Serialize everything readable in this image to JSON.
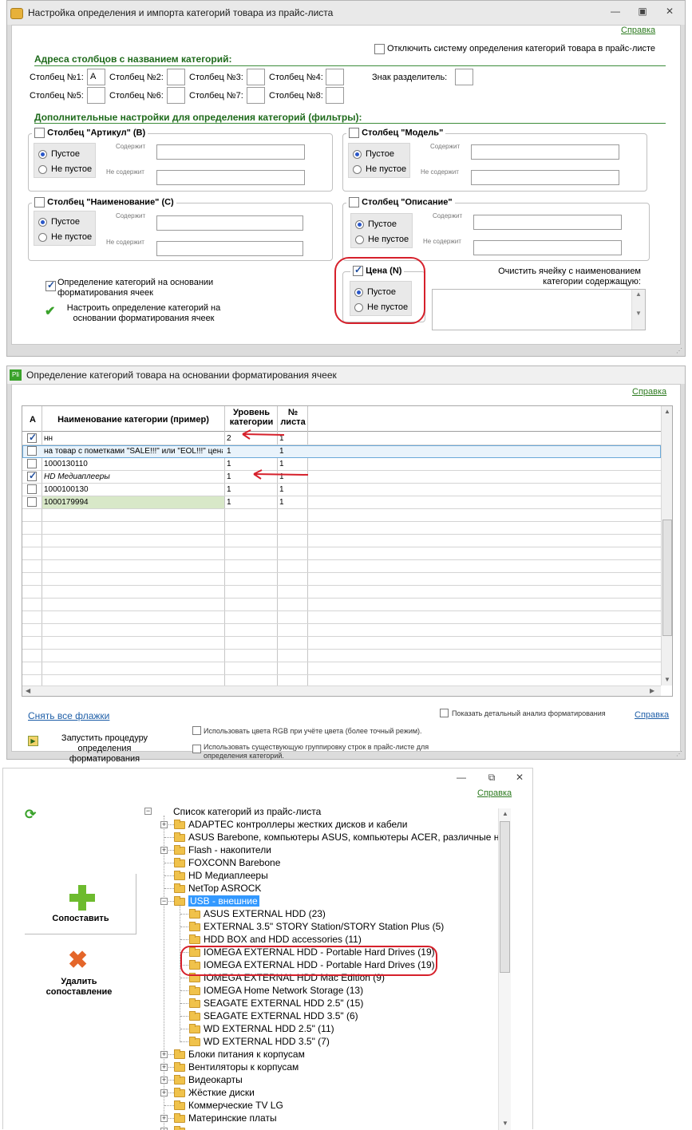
{
  "w1": {
    "title": "Настройка определения и импорта категорий товара из прайс-листа",
    "help": "Справка",
    "disable_label": "Отключить систему определения категорий товара в прайс-листе",
    "section1": "Адреса столбцов с названием категорий:",
    "col1": "Столбец №1:",
    "col1_value": "A",
    "col2": "Столбец №2:",
    "col3": "Столбец №3:",
    "col4": "Столбец №4:",
    "col5": "Столбец №5:",
    "col6": "Столбец №6:",
    "col7": "Столбец №7:",
    "col8": "Столбец №8:",
    "separator": "Знак разделитель:",
    "section2": "Дополнительные настройки для определения категорий (фильтры):",
    "g_article": "Столбец \"Артикул\" (B)",
    "g_model": "Столбец \"Модель\"",
    "g_name": "Столбец \"Наименование\" (C)",
    "g_desc": "Столбец \"Описание\"",
    "g_price": "Цена (N)",
    "empty": "Пустое",
    "not_empty": "Не пустое",
    "contains": "Содержит",
    "not_contains": "Не содержит",
    "format_cb": "Определение категорий на основании форматирования ячеек",
    "format_link": "Настроить определение категорий на основании форматирования ячеек",
    "clear_label": "Очистить ячейку с наименованием категории содержащую:"
  },
  "w2": {
    "title": "Определение категорий товара на основании форматирования ячеек",
    "help": "Справка",
    "headers": {
      "a": "A",
      "name": "Наименование категории (пример)",
      "level": "Уровень категории",
      "sheet": "№ листа"
    },
    "rows": [
      {
        "checked": true,
        "name": "нн",
        "level": "2",
        "sheet": "1",
        "style": "normal"
      },
      {
        "checked": false,
        "name": "на товар с пометками \"SALE!!!\" или \"EOL!!!\" цена",
        "level": "1",
        "sheet": "1",
        "style": "selected"
      },
      {
        "checked": false,
        "name": "1000130110",
        "level": "1",
        "sheet": "1",
        "style": "normal"
      },
      {
        "checked": true,
        "name": "HD Медиаплееры",
        "level": "1",
        "sheet": "1",
        "style": "italic"
      },
      {
        "checked": false,
        "name": "1000100130",
        "level": "1",
        "sheet": "1",
        "style": "normal"
      },
      {
        "checked": false,
        "name": "1000179994",
        "level": "1",
        "sheet": "1",
        "style": "green"
      }
    ],
    "clear_flags": "Снять все флажки",
    "detail_cb": "Показать детальный анализ форматирования",
    "help2": "Справка",
    "run": "Запустить процедуру определения форматирования",
    "rgb_cb": "Использовать цвета RGB при учёте цвета (более точный режим).",
    "group_cb": "Использовать существующую группировку строк в прайс-листе для определения категорий."
  },
  "w3": {
    "help": "Справка",
    "match_btn": "Сопоставить",
    "delete_btn": "Удалить сопоставление",
    "root": "Список категорий из прайс-листа",
    "top": [
      {
        "label": "ADAPTEC контроллеры жестких дисков и кабели",
        "exp": "+"
      },
      {
        "label": "ASUS Barebone, компьютеры ASUS, компьютеры ACER, различные н",
        "exp": ""
      },
      {
        "label": "Flash - накопители",
        "exp": "+"
      },
      {
        "label": "FOXCONN Barebone",
        "exp": ""
      },
      {
        "label": "HD Медиаплееры",
        "exp": ""
      },
      {
        "label": "NetTop ASROCK",
        "exp": ""
      },
      {
        "label": "USB - внешние",
        "exp": "−",
        "selected": true
      }
    ],
    "children": [
      "ASUS EXTERNAL HDD (23)",
      "EXTERNAL 3.5\" STORY Station/STORY Station Plus (5)",
      "HDD BOX and HDD accessories (11)",
      "IOMEGA EXTERNAL HDD - Portable Hard Drives (19)",
      "IOMEGA EXTERNAL HDD - Portable Hard Drives (19)",
      "IOMEGA EXTERNAL HDD Mac Edition (9)",
      "IOMEGA Home Network Storage (13)",
      "SEAGATE EXTERNAL HDD 2.5\" (15)",
      "SEAGATE EXTERNAL HDD 3.5\" (6)",
      "WD EXTERNAL HDD 2.5\" (11)",
      "WD EXTERNAL HDD 3.5\" (7)"
    ],
    "bottom": [
      {
        "label": "Блоки питания к корпусам",
        "exp": "+"
      },
      {
        "label": "Вентиляторы к корпусам",
        "exp": "+"
      },
      {
        "label": "Видеокарты",
        "exp": "+"
      },
      {
        "label": "Жёсткие диски",
        "exp": "+"
      },
      {
        "label": "Коммерческие TV LG",
        "exp": ""
      },
      {
        "label": "Материнские платы",
        "exp": "+"
      }
    ]
  }
}
